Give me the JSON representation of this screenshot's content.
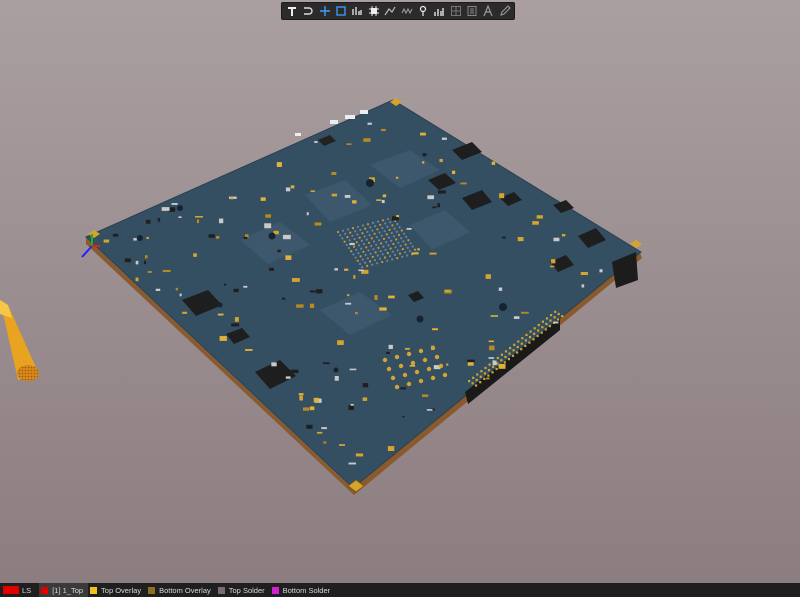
{
  "toolbar": {
    "tools": [
      {
        "name": "text-tool-icon"
      },
      {
        "name": "line-tool-icon"
      },
      {
        "name": "crosshair-tool-icon"
      },
      {
        "name": "rectangle-select-icon"
      },
      {
        "name": "chart-tool-icon"
      },
      {
        "name": "component-place-icon"
      },
      {
        "name": "route-tool-icon"
      },
      {
        "name": "waveform-tool-icon"
      },
      {
        "name": "probe-tool-icon"
      },
      {
        "name": "bar-graph-icon"
      },
      {
        "name": "grid-tool-icon"
      },
      {
        "name": "document-tool-icon"
      },
      {
        "name": "text-string-icon"
      },
      {
        "name": "edit-pen-icon"
      }
    ]
  },
  "layers": {
    "ls_label": "LS",
    "ls_color": "#e00000",
    "items": [
      {
        "label": "[1] 1_Top",
        "color": "#e00000",
        "active": true
      },
      {
        "label": "Top Overlay",
        "color": "#f0c020",
        "active": false
      },
      {
        "label": "Bottom Overlay",
        "color": "#8a7020",
        "active": false
      },
      {
        "label": "Top Solder",
        "color": "#7a6a78",
        "active": false
      },
      {
        "label": "Bottom Solder",
        "color": "#d020d0",
        "active": false
      }
    ]
  },
  "colors": {
    "board": "#344e62",
    "board_edge": "#8a5a2c",
    "copper_gold": "#d4a52e",
    "chip": "#1e1e1e"
  }
}
